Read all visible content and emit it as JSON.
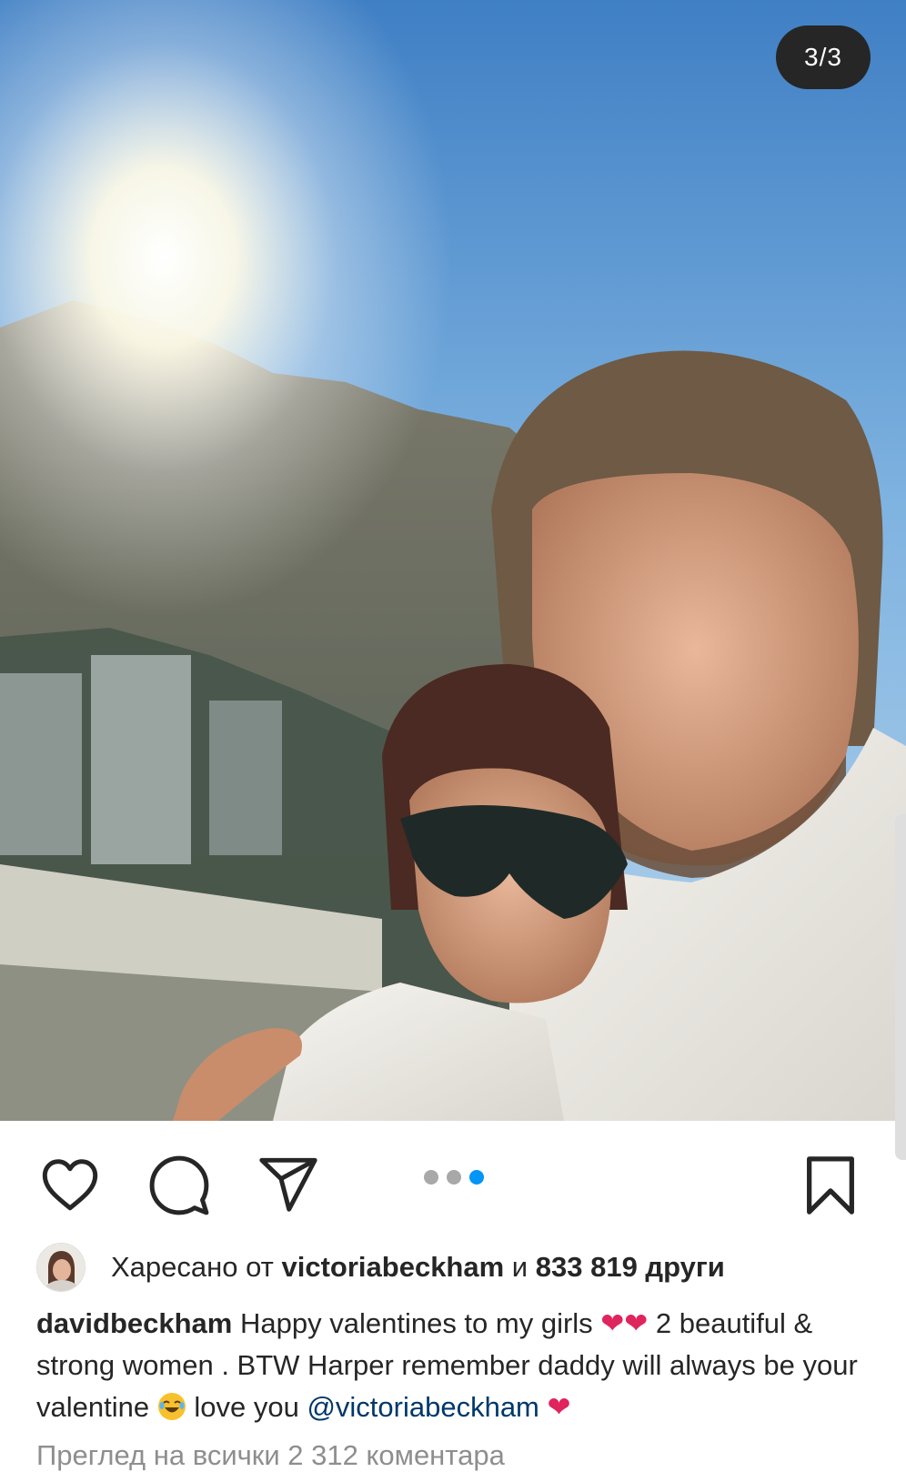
{
  "post": {
    "image_counter": "3/3",
    "photo_description_icon": "selfie-photo"
  },
  "actions": {
    "like_icon": "heart-outline-icon",
    "comment_icon": "comment-bubble-icon",
    "share_icon": "paper-plane-icon",
    "save_icon": "bookmark-icon",
    "carousel_dots": 3,
    "carousel_active": 3,
    "accent_color": "#0095f6"
  },
  "likes": {
    "prefix": "Харесано от",
    "user": "victoriabeckham",
    "conjunction": "и",
    "count_text": "833 819 други"
  },
  "caption": {
    "username": "davidbeckham",
    "text_1": "Happy valentines to my girls",
    "hearts_1": "❤❤",
    "text_2": "2 beautiful & strong women . BTW Harper remember daddy will always be your valentine",
    "text_3": "love you",
    "mention": "@victoriabeckham",
    "heart_2": "❤"
  },
  "comments": {
    "view_all": "Преглед на всички 2 312 коментара"
  }
}
